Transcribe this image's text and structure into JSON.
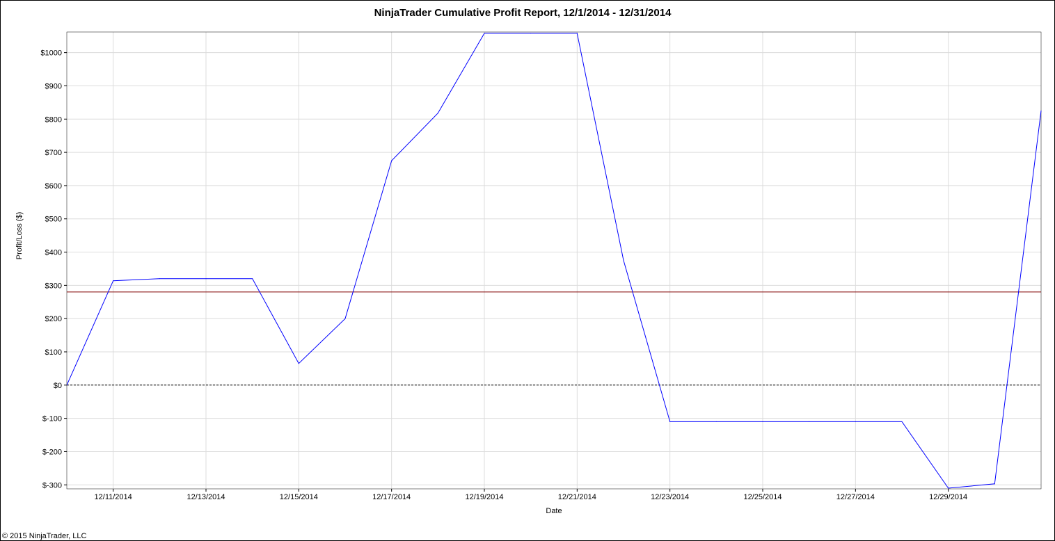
{
  "chart_data": {
    "type": "line",
    "title": "NinjaTrader Cumulative Profit Report, 12/1/2014 - 12/31/2014",
    "xlabel": "Date",
    "ylabel": "Profit/Loss ($)",
    "x_tick_labels": [
      "12/11/2014",
      "12/13/2014",
      "12/15/2014",
      "12/17/2014",
      "12/19/2014",
      "12/21/2014",
      "12/23/2014",
      "12/25/2014",
      "12/27/2014",
      "12/29/2014"
    ],
    "y_ticks": [
      -300,
      -200,
      -100,
      0,
      100,
      200,
      300,
      400,
      500,
      600,
      700,
      800,
      900,
      1000
    ],
    "y_tick_labels": [
      "$-300",
      "$-200",
      "$-100",
      "$0",
      "$100",
      "$200",
      "$300",
      "$400",
      "$500",
      "$600",
      "$700",
      "$800",
      "$900",
      "$1000"
    ],
    "xlim": [
      "12/10/2014",
      "12/31/2014"
    ],
    "ylim": [
      -312,
      1062
    ],
    "grid": true,
    "series": [
      {
        "color": "#0000ff",
        "x": [
          "12/10/2014",
          "12/11/2014",
          "12/12/2014",
          "12/13/2014",
          "12/14/2014",
          "12/15/2014",
          "12/16/2014",
          "12/17/2014",
          "12/18/2014",
          "12/19/2014",
          "12/20/2014",
          "12/21/2014",
          "12/22/2014",
          "12/23/2014",
          "12/24/2014",
          "12/25/2014",
          "12/26/2014",
          "12/27/2014",
          "12/28/2014",
          "12/29/2014",
          "12/30/2014",
          "12/31/2014"
        ],
        "values": [
          0,
          314,
          320,
          320,
          320,
          65,
          200,
          675,
          818,
          1058,
          1058,
          1058,
          375,
          -110,
          -110,
          -110,
          -110,
          -110,
          -110,
          -310,
          -297,
          825
        ]
      }
    ],
    "reference_lines": [
      {
        "value": 280,
        "color": "#800000",
        "style": "solid"
      },
      {
        "value": 0,
        "color": "#000000",
        "style": "dashed"
      }
    ]
  },
  "footer": {
    "copyright": "© 2015 NinjaTrader, LLC"
  }
}
